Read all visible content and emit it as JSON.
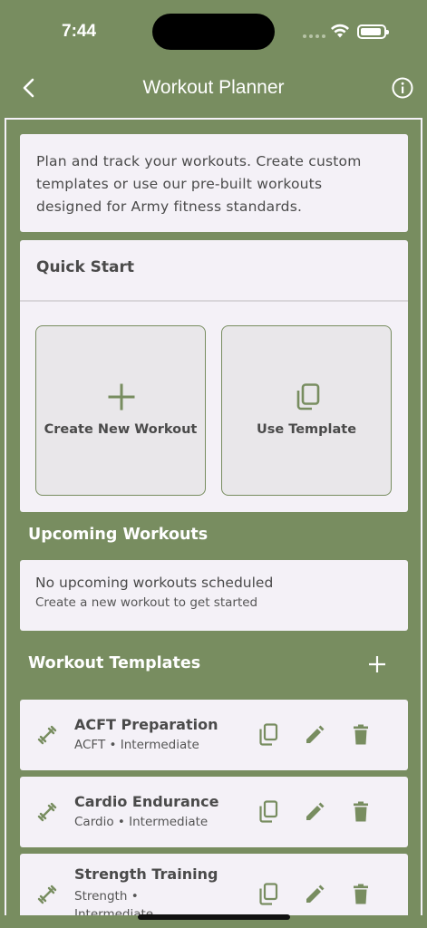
{
  "status_bar": {
    "time": "7:44"
  },
  "app_bar": {
    "title": "Workout Planner"
  },
  "intro": {
    "text": "Plan and track your workouts. Create custom templates or use our pre-built workouts designed for Army fitness standards."
  },
  "quick_start": {
    "title": "Quick Start",
    "create_label": "Create New Workout",
    "template_label": "Use Template"
  },
  "upcoming": {
    "heading": "Upcoming Workouts",
    "empty_title": "No upcoming workouts scheduled",
    "empty_subtitle": "Create a new workout to get started"
  },
  "templates": {
    "heading": "Workout Templates",
    "items": [
      {
        "name": "ACFT Preparation",
        "meta": "ACFT • Intermediate"
      },
      {
        "name": "Cardio Endurance",
        "meta": "Cardio • Intermediate"
      },
      {
        "name": "Strength Training",
        "meta": "Strength • Intermediate"
      }
    ]
  },
  "colors": {
    "brand": "#788d60",
    "card": "#f4f1f7",
    "text": "#4a4a4a"
  }
}
